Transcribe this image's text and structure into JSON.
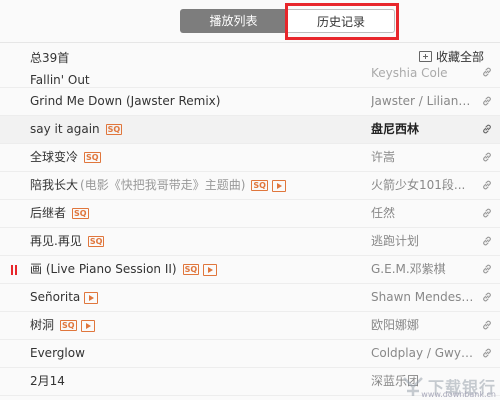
{
  "tabs": {
    "play_list": "播放列表",
    "history": "历史记录"
  },
  "header": {
    "total": "总39首",
    "favorite_all": "收藏全部"
  },
  "songs": [
    {
      "title": "Fallin' Out",
      "sub": "",
      "artist": "Keyshia Cole",
      "sq": false,
      "mv": false
    },
    {
      "title": "Grind Me Down (Jawster Remix)",
      "sub": "",
      "artist": "Jawster / Liliann...",
      "sq": false,
      "mv": false
    },
    {
      "title": "say it again",
      "sub": "",
      "artist": "盘尼西林",
      "sq": true,
      "mv": false
    },
    {
      "title": "全球变冷",
      "sub": "",
      "artist": "许嵩",
      "sq": true,
      "mv": false
    },
    {
      "title": "陪我长大",
      "sub": "(电影《快把我哥带走》主题曲)",
      "artist": "火箭少女101段...",
      "sq": true,
      "mv": true
    },
    {
      "title": "后继者",
      "sub": "",
      "artist": "任然",
      "sq": true,
      "mv": false
    },
    {
      "title": "再见.再见",
      "sub": "",
      "artist": "逃跑计划",
      "sq": true,
      "mv": false
    },
    {
      "title": "画 (Live Piano Session II)",
      "sub": "",
      "artist": "G.E.M.邓紫棋",
      "sq": true,
      "mv": true
    },
    {
      "title": "Señorita",
      "sub": "",
      "artist": "Shawn Mendes ...",
      "sq": false,
      "mv": true
    },
    {
      "title": "树洞",
      "sub": "",
      "artist": "欧阳娜娜",
      "sq": true,
      "mv": true
    },
    {
      "title": "Everglow",
      "sub": "",
      "artist": "Coldplay / Gwyn...",
      "sq": false,
      "mv": false
    },
    {
      "title": "2月14",
      "sub": "",
      "artist": "深蓝乐团",
      "sq": false,
      "mv": false
    }
  ],
  "badge_sq": "SQ",
  "watermark": {
    "text": "下载银行",
    "url": "www.downbank.cn"
  }
}
